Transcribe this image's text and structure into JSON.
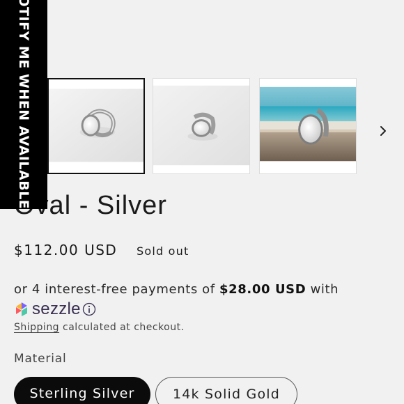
{
  "notify_banner": {
    "label": "NOTIFY ME WHEN AVAILABLE"
  },
  "gallery": {
    "thumbnails": [
      {
        "icon": "ring-photo-white-background",
        "selected": true
      },
      {
        "icon": "ring-photo-white-background",
        "selected": false
      },
      {
        "icon": "ring-photo-beach-background",
        "selected": false
      }
    ],
    "next_icon": "chevron-right-icon"
  },
  "product": {
    "title": "Oval - Silver",
    "price": "$112.00 USD",
    "status": "Sold out"
  },
  "installments": {
    "prefix": "or 4 interest-free payments of ",
    "amount": "$28.00 USD",
    "suffix": " with"
  },
  "sezzle": {
    "brand": "sezzle",
    "info_icon": "info-icon",
    "colors": [
      "#ff5a5f",
      "#f7b733",
      "#4cc9a6",
      "#7b61ff"
    ]
  },
  "shipping": {
    "link": "Shipping",
    "rest": " calculated at checkout."
  },
  "material": {
    "label": "Material",
    "options": [
      {
        "label": "Sterling Silver",
        "selected": true
      },
      {
        "label": "14k Solid Gold",
        "selected": false
      }
    ]
  },
  "colors": {
    "background": "#f1f1f1",
    "text": "#1a1a1a",
    "selected_pill": "#0b0b0b",
    "banner": "#000000"
  }
}
